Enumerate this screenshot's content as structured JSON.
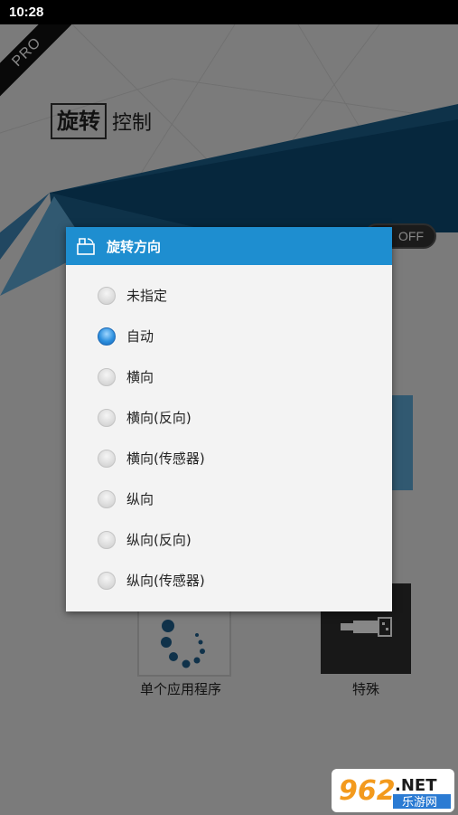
{
  "status_bar": {
    "time": "10:28"
  },
  "background_app": {
    "pro_badge": "PRO",
    "title_boxed": "旋转",
    "title_rest": "控制",
    "toggle_text": "OFF",
    "tiles": [
      {
        "label": "单个应用程序"
      },
      {
        "label": "特殊"
      }
    ],
    "watermark": {
      "number": "962",
      "suffix": ".NET",
      "subtitle": "乐游网"
    }
  },
  "dialog": {
    "title": "旋转方向",
    "selected_index": 1,
    "options": [
      {
        "label": "未指定"
      },
      {
        "label": "自动"
      },
      {
        "label": "横向"
      },
      {
        "label": "横向(反向)"
      },
      {
        "label": "横向(传感器)"
      },
      {
        "label": "纵向"
      },
      {
        "label": "纵向(反向)"
      },
      {
        "label": "纵向(传感器)"
      }
    ]
  },
  "colors": {
    "accent": "#1e8ed0",
    "dialog_bg": "#f3f3f3",
    "status_bar": "#000000"
  }
}
